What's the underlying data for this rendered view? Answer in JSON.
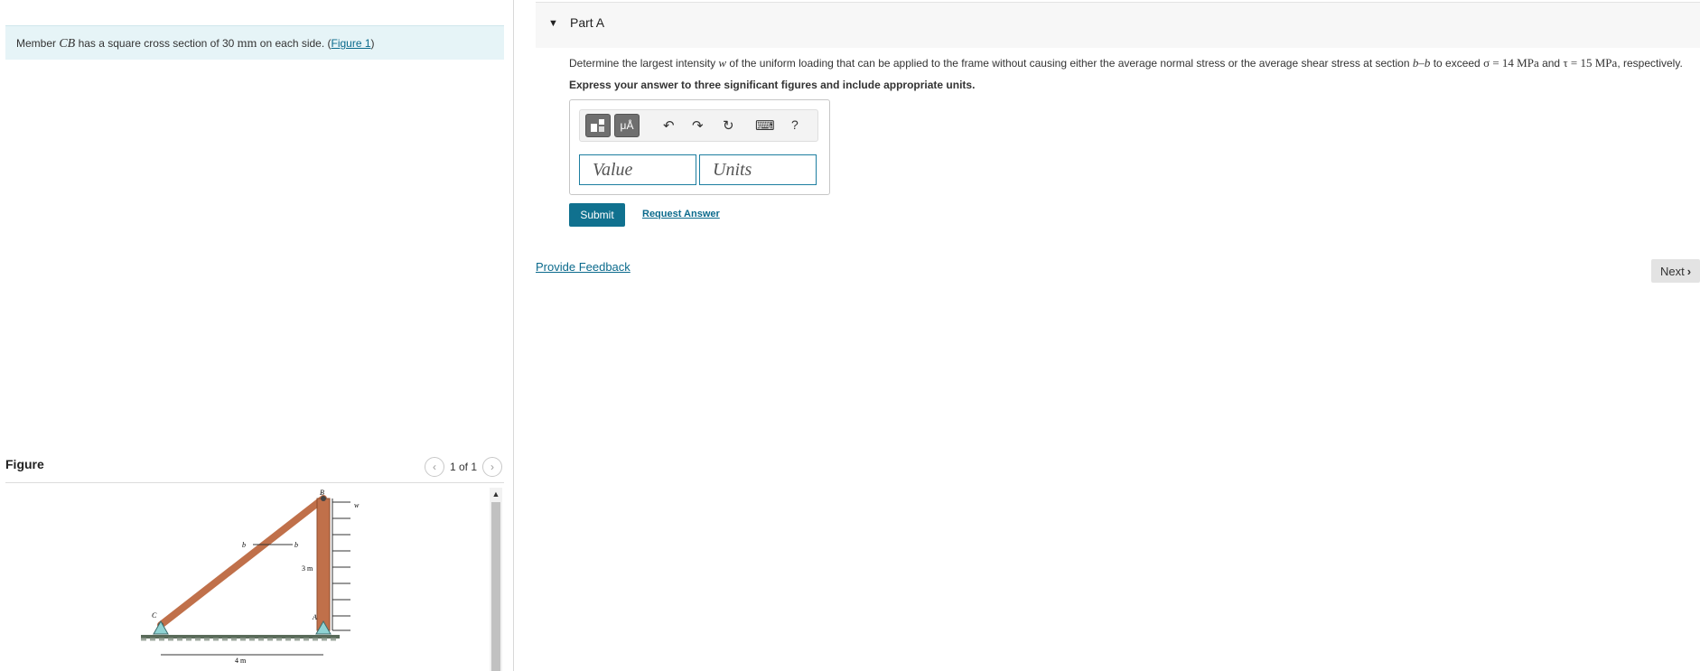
{
  "intro": {
    "prefix": "Member ",
    "member": "CB",
    "middle": " has a square cross section of 30 ",
    "unit": "mm",
    "suffix": " on each side. (",
    "figure_link": "Figure 1",
    "close": ")"
  },
  "figure": {
    "title": "Figure",
    "pager_text": "1 of 1",
    "labels": {
      "B": "B",
      "w": "w",
      "b1": "b",
      "b2": "b",
      "height": "3 m",
      "C": "C",
      "A": "A",
      "width": "4 m"
    }
  },
  "part": {
    "title": "Part A",
    "question_text": "Determine the largest intensity ",
    "w_symbol": "w",
    "question_mid": " of the uniform loading that can be applied to the frame without causing either the average normal stress or the average shear stress at section ",
    "section": "b–b",
    "question_mid2": " to exceed ",
    "sigma": "σ = 14 MPa",
    "and": " and ",
    "tau": "τ = 15 MPa",
    "question_end": ", respectively.",
    "instructions": "Express your answer to three significant figures and include appropriate units."
  },
  "toolbar": {
    "units_btn": "μÅ",
    "undo_icon": "↶",
    "redo_icon": "↷",
    "reset_icon": "↻",
    "keyboard_icon": "⌨",
    "help_label": "?"
  },
  "inputs": {
    "value_placeholder": "Value",
    "units_placeholder": "Units"
  },
  "actions": {
    "submit": "Submit",
    "request_answer": "Request Answer",
    "feedback": "Provide Feedback",
    "next": "Next"
  }
}
